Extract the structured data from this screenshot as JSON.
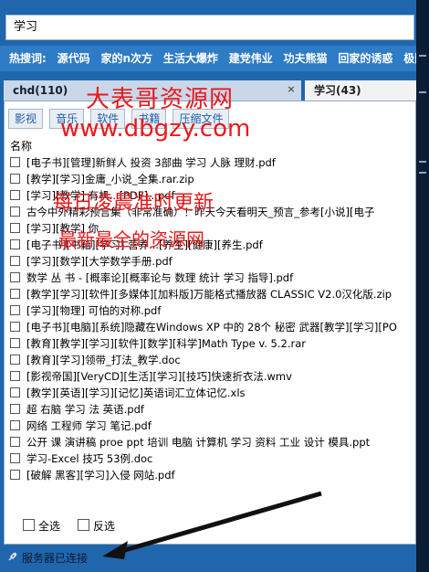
{
  "search": {
    "value": "学习"
  },
  "hotwords": {
    "label": "热搜词:",
    "items": [
      "源代码",
      "家的n次方",
      "生活大爆炸",
      "建党伟业",
      "功夫熊猫",
      "回家的诱惑",
      "极限"
    ]
  },
  "tabs": [
    {
      "label": "chd(110)",
      "close": "×"
    },
    {
      "label": "学习(43)"
    }
  ],
  "categories": [
    "影视",
    "音乐",
    "软件",
    "书籍",
    "压缩文件"
  ],
  "list": {
    "column_header": "名称",
    "items": [
      "[电子书][管理]新鲜人 投资 3部曲 学习 人脉 理财.pdf",
      "[教学][学习]金庸_小说_全集.rar.zip",
      "[学习][教学] 有机...[PDF]...pdf",
      "古今中外精彩预言集（非常准确）！昨天今天看明天_预言_参考[小说][电子",
      "[学习][教学] 你...",
      "[电子书][书籍][学习] 营养...[养生][健康][养生.pdf",
      "[学习][数学][大学数学手册.pdf",
      "数学 丛 书 - [概率论][概率论与 数理 统计 学习 指导].pdf",
      "[教学][学习][软件][多媒体][加料版]万能格式播放器 CLASSIC V2.0汉化版.zip",
      "[学习][物理] 可怕的对称.pdf",
      "[电子书][电脑][系统]隐藏在Windows XP 中的 28个 秘密 武器[教学][学习][PO",
      "[教育][教学][学习][软件][数学][科学]Math Type v. 5.2.rar",
      "[教育][学习]领带_打法_教学.doc",
      "[影视帝国][VeryCD][生活][学习][技巧]快速折衣法.wmv",
      "[教学][英语][学习][记忆]英语词汇立体记忆.xls",
      "超 右脑 学习 法 英语.pdf",
      "网络 工程师 学习 笔记.pdf",
      "公开 课 演讲稿 proe ppt 培训 电脑 计算机 学习 资料 工业 设计 模具.ppt",
      "学习-Excel 技巧 53例.doc",
      "[破解 黑客][学习]入侵 网站.pdf"
    ]
  },
  "footer": {
    "select_all": "全选",
    "invert": "反选"
  },
  "status": {
    "text": "服务器已连接"
  },
  "watermarks": [
    "大表哥资源网",
    "www.dbgzy.com",
    "每日凌晨准时更新",
    "最新最全的资源网"
  ],
  "colors": {
    "frame": "#1f66ad",
    "accent": "#2e7bc6",
    "watermark": "#e8191b"
  }
}
